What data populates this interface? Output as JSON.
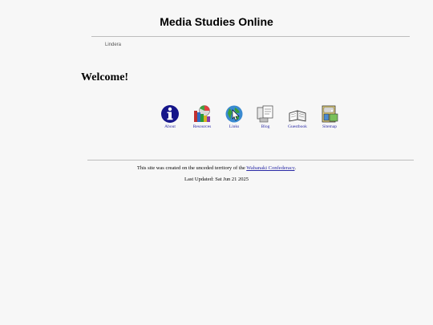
{
  "header": {
    "title": "Media Studies Online"
  },
  "breadcrumb": {
    "text": "Lindera"
  },
  "main": {
    "welcome": "Welcome!"
  },
  "nav": {
    "items": [
      {
        "label": "About",
        "icon": "info-icon"
      },
      {
        "label": "Resources",
        "icon": "books-icon"
      },
      {
        "label": "Links",
        "icon": "globe-icon"
      },
      {
        "label": "Blog",
        "icon": "notepad-icon"
      },
      {
        "label": "Guestbook",
        "icon": "open-book-icon"
      },
      {
        "label": "Sitemap",
        "icon": "filing-icon"
      }
    ]
  },
  "footer": {
    "created_prefix": "This site was created on the unceded territory of the ",
    "link_text": "Wabanaki Confederacy",
    "created_suffix": ".",
    "updated": "Last Updated: Sat Jun 21 2025"
  },
  "colors": {
    "link": "#2a2aa6",
    "background": "#f7f7f7",
    "rule": "#bdbdbd"
  }
}
